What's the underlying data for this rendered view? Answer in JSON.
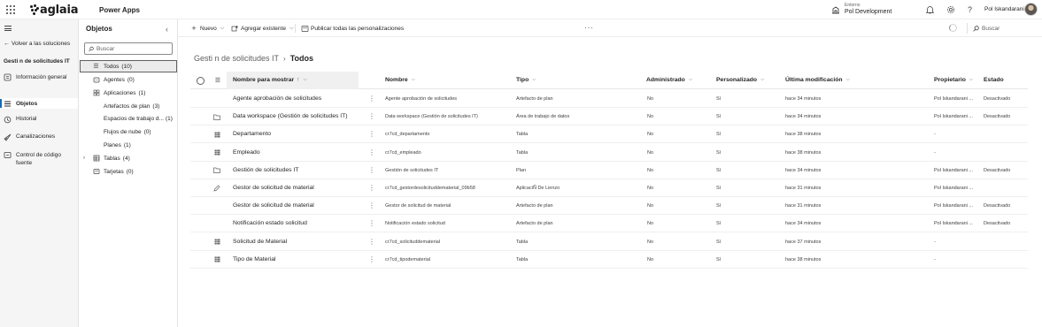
{
  "header": {
    "brand": "aglaia",
    "app_name": "Power Apps",
    "env_label": "Entorno",
    "env_name": "Pol Development",
    "user_name": "Pol Iskandarani"
  },
  "leftnav": {
    "back_label": "Volver a las soluciones",
    "solution_name": "Gesti n de solicitudes IT",
    "items": [
      {
        "label": "Información general",
        "icon": "info-icon"
      },
      {
        "label": "Objetos",
        "icon": "list-icon",
        "active": true
      },
      {
        "label": "Historial",
        "icon": "history-icon"
      },
      {
        "label": "Canalizaciones",
        "icon": "rocket-icon"
      },
      {
        "label": "Control de código fuente",
        "icon": "source-control-icon"
      }
    ]
  },
  "objects": {
    "title": "Objetos",
    "search_placeholder": "Buscar",
    "items": [
      {
        "label": "Todos",
        "count": "(10)"
      },
      {
        "label": "Agentes",
        "count": "(0)"
      },
      {
        "label": "Aplicaciones",
        "count": "(1)"
      },
      {
        "label": "Artefactos de plan",
        "count": "(3)"
      },
      {
        "label": "Espacios de trabajo d...",
        "count": "(1)"
      },
      {
        "label": "Flujos de nube",
        "count": "(0)"
      },
      {
        "label": "Planes",
        "count": "(1)"
      },
      {
        "label": "Tablas",
        "count": "(4)"
      },
      {
        "label": "Tarjetas",
        "count": "(0)"
      }
    ]
  },
  "commandbar": {
    "new_label": "Nuevo",
    "add_existing_label": "Agregar existente",
    "publish_label": "Publicar todas las personalizaciones",
    "search_placeholder": "Buscar"
  },
  "breadcrumb": {
    "parent": "Gesti n de solicitudes IT",
    "current": "Todos"
  },
  "table": {
    "columns": {
      "display_name": "Nombre para mostrar",
      "name": "Nombre",
      "type": "Tipo",
      "managed": "Administrado",
      "customized": "Personalizado",
      "modified": "Última modificación",
      "owner": "Propietario",
      "status": "Estado"
    },
    "sort_indicator": "↑",
    "rows": [
      {
        "icon": "none",
        "display": "Agente aprobación de solicitudes",
        "name": "Agente aprobación de solicitudes",
        "type": "Artefacto de plan",
        "managed": "No",
        "customized": "Sí",
        "modified": "hace 34 minutos",
        "owner": "Pol Iskandarani ...",
        "status": "Desactivado"
      },
      {
        "icon": "folder-icon",
        "display": "Data workspace (Gestión de solicitudes IT)",
        "name": "Data workspace (Gestión de solicitudes IT)",
        "type": "Área de trabajo de datos",
        "managed": "No",
        "customized": "Sí",
        "modified": "hace 34 minutos",
        "owner": "Pol Iskandarani ...",
        "status": "Desactivado"
      },
      {
        "icon": "table-icon",
        "display": "Departamento",
        "name": "cr7cd_departamento",
        "type": "Tabla",
        "managed": "No",
        "customized": "Sí",
        "modified": "hace 38 minutos",
        "owner": "-",
        "status": ""
      },
      {
        "icon": "table-icon",
        "display": "Empleado",
        "name": "cr7cd_empleado",
        "type": "Tabla",
        "managed": "No",
        "customized": "Sí",
        "modified": "hace 38 minutos",
        "owner": "-",
        "status": ""
      },
      {
        "icon": "folder-icon",
        "display": "Gestión de solicitudes IT",
        "name": "Gestión de solicitudes IT",
        "type": "Plan",
        "managed": "No",
        "customized": "Sí",
        "modified": "hace 34 minutos",
        "owner": "Pol Iskandarani ...",
        "status": "Desactivado"
      },
      {
        "icon": "pencil-icon",
        "display": "Gestor de solicitud de material",
        "name": "cr7cd_gestordesolicituddematerial_09b58",
        "type": "AplicaciÑ De Lienzo",
        "managed": "No",
        "customized": "Sí",
        "modified": "hace 31 minutos",
        "owner": "Pol Iskandarani ...",
        "status": ""
      },
      {
        "icon": "none",
        "display": "Gestor de solicitud de material",
        "name": "Gestor de solicitud de material",
        "type": "Artefacto de plan",
        "managed": "No",
        "customized": "Sí",
        "modified": "hace 31 minutos",
        "owner": "Pol Iskandarani ...",
        "status": "Desactivado"
      },
      {
        "icon": "none",
        "display": "Notificación estado solicitud",
        "name": "Notificación estado solicitud",
        "type": "Artefacto de plan",
        "managed": "No",
        "customized": "Sí",
        "modified": "hace 34 minutos",
        "owner": "Pol Iskandarani ...",
        "status": "Desactivado"
      },
      {
        "icon": "table-icon",
        "display": "Solicitud de Material",
        "name": "cr7cd_solicituddematerial",
        "type": "Tabla",
        "managed": "No",
        "customized": "Sí",
        "modified": "hace 37 minutos",
        "owner": "-",
        "status": ""
      },
      {
        "icon": "table-icon",
        "display": "Tipo de Material",
        "name": "cr7cd_tipodematerial",
        "type": "Tabla",
        "managed": "No",
        "customized": "Sí",
        "modified": "hace 38 minutos",
        "owner": "-",
        "status": ""
      }
    ]
  },
  "colors": {
    "accent": "#0f6cbd",
    "nav_bg": "#f5f5f5",
    "selected_bg": "#ebebeb"
  }
}
